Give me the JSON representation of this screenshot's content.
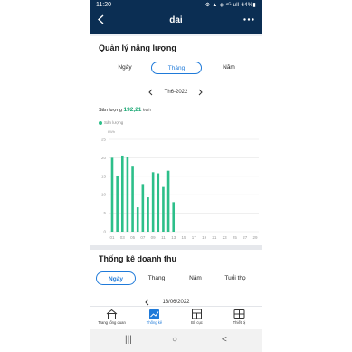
{
  "status_bar": {
    "time": "11:20",
    "right_indicators": "⚙ ▲ ◈ ⁴ᴳ ull 64%▮"
  },
  "app_bar": {
    "title": "dai"
  },
  "energy": {
    "title": "Quản lý năng lượng",
    "tabs": [
      {
        "label": "Ngày"
      },
      {
        "label": "Tháng"
      },
      {
        "label": "Năm"
      }
    ],
    "active_tab": "Tháng",
    "period": "Th6-2022",
    "output_label": "Sản lượng",
    "output_value": "192,21",
    "output_unit": "kWh",
    "legend": "Sản lượng",
    "y_unit": "kWh"
  },
  "chart_data": {
    "type": "bar",
    "series_name": "Sản lượng",
    "unit": "kWh",
    "ylim": [
      0,
      25
    ],
    "y_ticks": [
      0,
      5,
      10,
      15,
      20,
      25
    ],
    "x_tick_labels": [
      "01",
      "03",
      "05",
      "07",
      "09",
      "11",
      "13",
      "15",
      "17",
      "19",
      "21",
      "23",
      "25",
      "27",
      "29"
    ],
    "x_range": [
      1,
      29
    ],
    "days": [
      1,
      2,
      3,
      4,
      5,
      6,
      7,
      8,
      9,
      10,
      11,
      12,
      13,
      14
    ],
    "values": [
      20.0,
      15.2,
      20.6,
      20.2,
      17.6,
      6.6,
      12.9,
      9.3,
      16.1,
      15.8,
      12.1,
      16.5,
      8.0,
      0.0
    ],
    "bar_color": "#2dbf8a",
    "grid": true
  },
  "revenue": {
    "title": "Thống kê doanh thu",
    "tabs": [
      {
        "label": "Ngày"
      },
      {
        "label": "Tháng"
      },
      {
        "label": "Năm"
      },
      {
        "label": "Tuổi thọ"
      }
    ],
    "active_tab": "Ngày",
    "period": "13/06/2022"
  },
  "bottom_nav": [
    {
      "label": "Trang tổng quan",
      "icon": "home-icon"
    },
    {
      "label": "Thống kê",
      "icon": "stats-icon"
    },
    {
      "label": "Bố cục",
      "icon": "layout-icon"
    },
    {
      "label": "Thiết bị",
      "icon": "device-icon"
    }
  ],
  "active_nav": "Thống kê",
  "system_nav": {
    "recents": "|||",
    "home": "○",
    "back": "<"
  },
  "colors": {
    "header": "#0b2e53",
    "accent": "#1f7ad9",
    "bar": "#2dbf8a",
    "output_value": "#1aa874"
  }
}
